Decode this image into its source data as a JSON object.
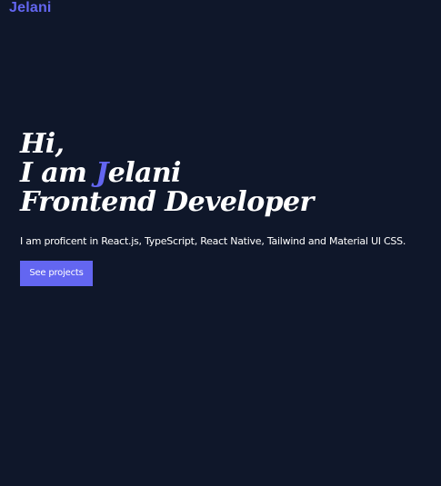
{
  "nav": {
    "brand": "Jelani"
  },
  "hero": {
    "greeting": "Hi,",
    "intro_prefix": "I am ",
    "intro_initial": "J",
    "intro_rest": "elani",
    "role": "Frontend Developer",
    "description": "I am proficent in React.js, TypeScript, React Native, Tailwind and Material UI CSS.",
    "cta_label": "See projects"
  },
  "colors": {
    "background": "#0f172a",
    "accent": "#6366f1",
    "text": "#ffffff"
  }
}
